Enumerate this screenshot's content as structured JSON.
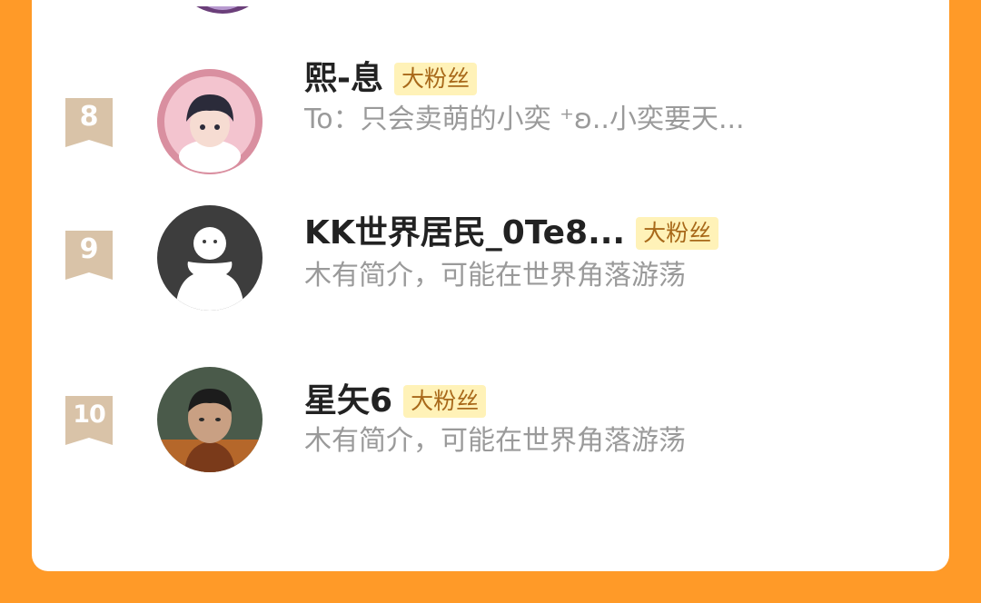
{
  "badge_label": "大粉丝",
  "colors": {
    "background": "#FF9A28",
    "badge_bg": "#FFF2B8",
    "badge_text": "#A8691A",
    "rank_ribbon": "#D9C3A8"
  },
  "rows": [
    {
      "rank": "8",
      "name": "熙-息",
      "badge": "大粉丝",
      "description": "To：只会卖萌的小奕 ⁺ʚ..小奕要天...",
      "avatar": "anime-boy-avatar"
    },
    {
      "rank": "9",
      "name": "KK世界居民_0Te8...",
      "badge": "大粉丝",
      "description": "木有简介，可能在世界角落游荡",
      "avatar": "default-avatar"
    },
    {
      "rank": "10",
      "name": "星矢6",
      "badge": "大粉丝",
      "description": "木有简介，可能在世界角落游荡",
      "avatar": "child-photo-avatar"
    }
  ]
}
